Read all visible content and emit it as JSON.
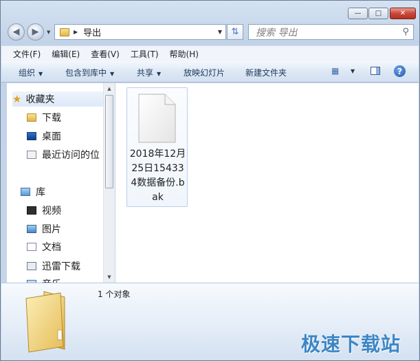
{
  "address": {
    "path": "导出"
  },
  "search": {
    "placeholder": "搜索 导出"
  },
  "menu": [
    "文件(F)",
    "编辑(E)",
    "查看(V)",
    "工具(T)",
    "帮助(H)"
  ],
  "toolbar": {
    "organize": "组织",
    "include": "包含到库中",
    "share": "共享",
    "slideshow": "放映幻灯片",
    "newfolder": "新建文件夹"
  },
  "nav": {
    "favorites": "收藏夹",
    "downloads": "下载",
    "desktop": "桌面",
    "recent": "最近访问的位",
    "libraries": "库",
    "videos": "视频",
    "pictures": "图片",
    "documents": "文档",
    "xunlei": "迅雷下载",
    "music": "音乐"
  },
  "file": {
    "name": "2018年12月25日154334数据备份.bak"
  },
  "details": {
    "count": "1 个对象"
  },
  "watermark": "极速下载站",
  "icons": {
    "back": "arrow-left-icon",
    "forward": "arrow-right-icon",
    "refresh": "refresh-icon",
    "search": "search-icon",
    "help": "help-icon"
  }
}
